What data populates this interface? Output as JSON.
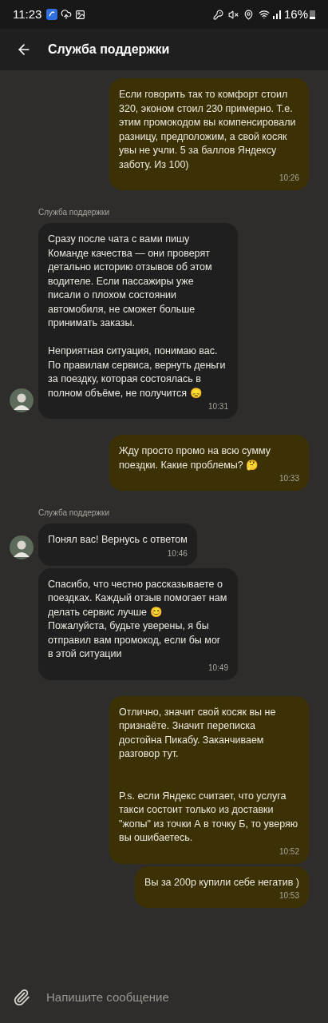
{
  "status_bar": {
    "time": "11:23",
    "battery": "16%"
  },
  "header": {
    "title": "Служба поддержки"
  },
  "messages": [
    {
      "kind": "out",
      "text": "Если говорить так то комфорт стоил 320, эконом стоил 230 примерно. Т.е. этим промокодом вы компенсировали разницу, предположим, а свой косяк увы не учли. 5 за баллов Яндексу заботу. Из 100)",
      "time": "10:26"
    },
    {
      "kind": "in",
      "sender_label": "Служба поддержки",
      "avatar": true,
      "text": "Сразу после чата с вами пишу Команде качества — они проверят детально историю отзывов об этом водителе. Если пассажиры уже писали о плохом состоянии автомобиля, не сможет больше принимать заказы.\n\nНеприятная ситуация, понимаю вас. По правилам сервиса, вернуть деньги за поездку, которая состоялась в полном объёме, не получится 😞",
      "time": "10:31"
    },
    {
      "kind": "out",
      "text": "Жду просто промо на всю сумму поездки. Какие проблемы? 🤔",
      "time": "10:33"
    },
    {
      "kind": "in",
      "sender_label": "Служба поддержки",
      "avatar": true,
      "text": "Понял вас! Вернусь с ответом",
      "time": "10:46"
    },
    {
      "kind": "in",
      "avatar": false,
      "text": "Спасибо, что честно рассказываете о поездках. Каждый отзыв помогает нам делать сервис лучше 😊\nПожалуйста, будьте уверены, я бы отправил вам промокод, если бы мог в этой ситуации",
      "time": "10:49"
    },
    {
      "kind": "out",
      "text": "Отлично, значит свой косяк вы не признаёте. Значит переписка достойна Пикабу. Заканчиваем разговор тут.\n\n\nP.s. если Яндекс считает, что услуга такси состоит только из доставки \"жопы\" из точки А в точку Б, то уверяю вы ошибаетесь.",
      "time": "10:52"
    },
    {
      "kind": "out",
      "text": "Вы за 200р купили себе негатив )",
      "time": "10:53"
    }
  ],
  "composer": {
    "placeholder": "Напишите сообщение"
  }
}
